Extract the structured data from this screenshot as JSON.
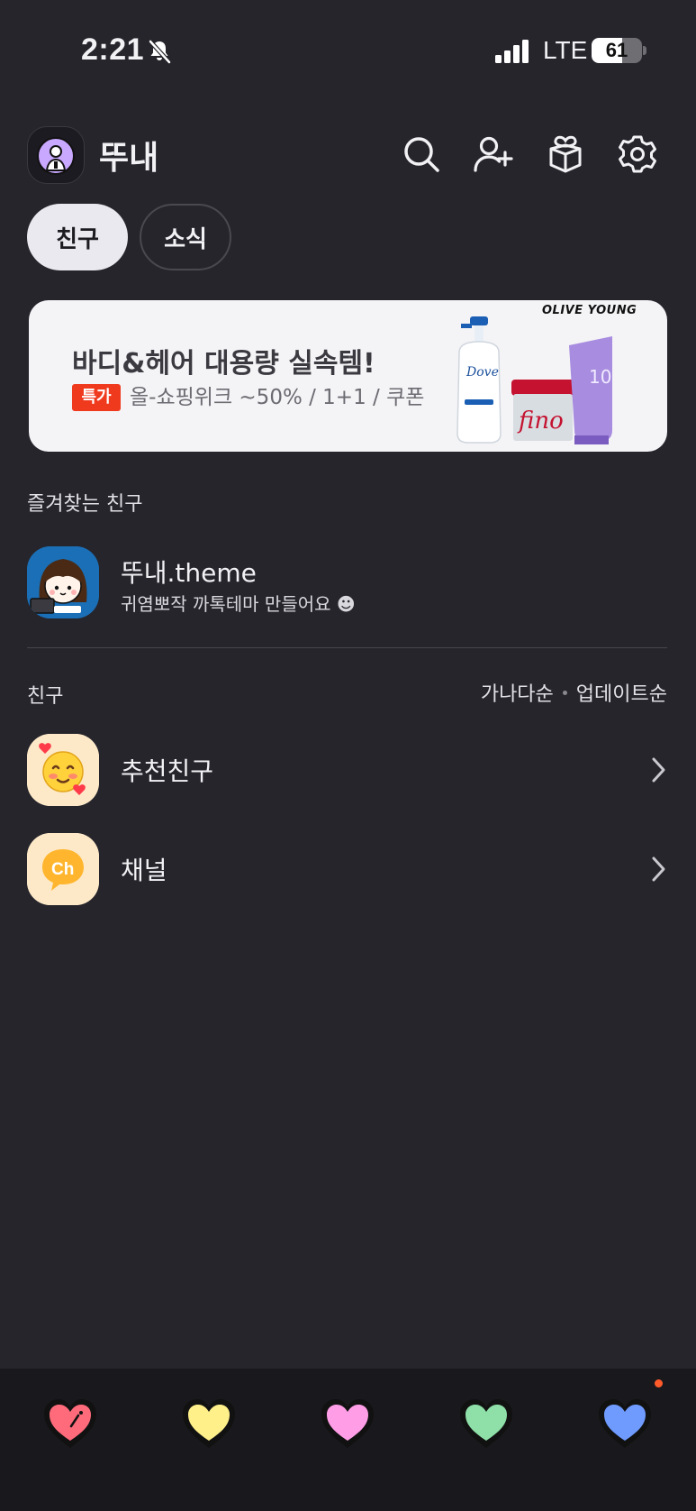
{
  "status_bar": {
    "time": "2:21",
    "network": "LTE",
    "battery": "61",
    "battery_level": 0.61
  },
  "header": {
    "profile_name": "뚜내",
    "icons": [
      "search-icon",
      "add-friend-icon",
      "gift-box-icon",
      "settings-gear-icon"
    ]
  },
  "tabs": [
    {
      "label": "친구",
      "active": true
    },
    {
      "label": "소식",
      "active": false
    }
  ],
  "banner": {
    "title": "바디&헤어 대용량 실속템!",
    "badge": "특가",
    "subtitle": "올-쇼핑위크 ~50% / 1+1 / 쿠폰",
    "brand": "OLIVE YOUNG",
    "colors": {
      "badge": "#f03a1e",
      "background": "#f4f4f6"
    }
  },
  "favorites": {
    "label": "즐겨찾는 친구",
    "items": [
      {
        "name": "뚜내.theme",
        "status": "귀염뽀작 까톡테마 만들어요 ☻"
      }
    ]
  },
  "friends": {
    "label": "친구",
    "sort_options": [
      "가나다순",
      "업데이트순"
    ],
    "items": [
      {
        "label": "추천친구",
        "icon": "blushing-face-icon"
      },
      {
        "label": "채널",
        "icon": "channel-chat-icon"
      }
    ]
  },
  "bottom_nav": {
    "items": [
      {
        "icon": "red-heart-icon",
        "color": "#ff6b7a"
      },
      {
        "icon": "yellow-heart-icon",
        "color": "#fff08a"
      },
      {
        "icon": "pink-heart-icon",
        "color": "#ff9ee6"
      },
      {
        "icon": "green-heart-icon",
        "color": "#8ee0a8"
      },
      {
        "icon": "blue-heart-icon",
        "color": "#6f9bff"
      }
    ],
    "notification_color": "#ff5a2a"
  }
}
